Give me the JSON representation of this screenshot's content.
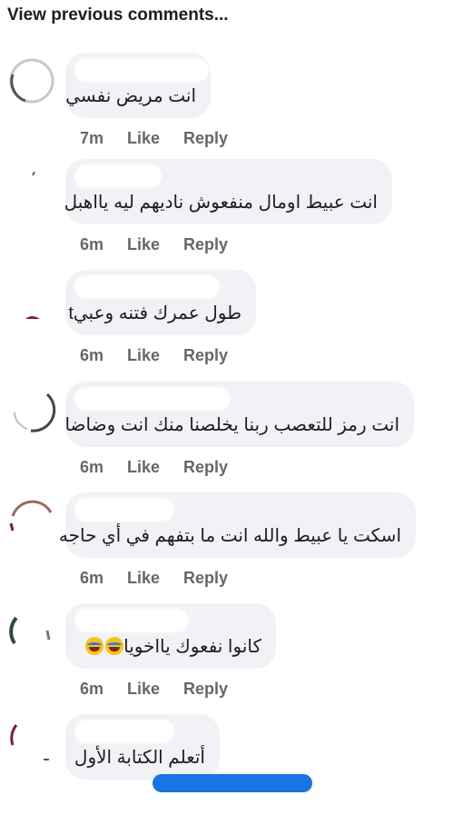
{
  "header": {
    "view_previous": "View previous comments..."
  },
  "comments": [
    {
      "text": "انت مريض نفسي",
      "time": "7m",
      "like": "Like",
      "reply": "Reply"
    },
    {
      "text": "انت عبيط اومال منفعوش ناديهم ليه يااهبل",
      "time": "6m",
      "like": "Like",
      "reply": "Reply"
    },
    {
      "text": "طول عمرك فتنه وعبيt",
      "time": "6m",
      "like": "Like",
      "reply": "Reply"
    },
    {
      "text": "انت رمز للتعصب ربنا يخلصنا منك انت وضاضا",
      "time": "6m",
      "like": "Like",
      "reply": "Reply"
    },
    {
      "text": "اسكت يا عبيط والله انت ما بتفهم في أي حاجه",
      "time": "6m",
      "like": "Like",
      "reply": "Reply"
    },
    {
      "text": "كانوا نفعوك يااخويا",
      "emojis": "😂😂",
      "time": "6m",
      "like": "Like",
      "reply": "Reply"
    },
    {
      "text": "أتعلم الكتابة الأول"
    }
  ]
}
